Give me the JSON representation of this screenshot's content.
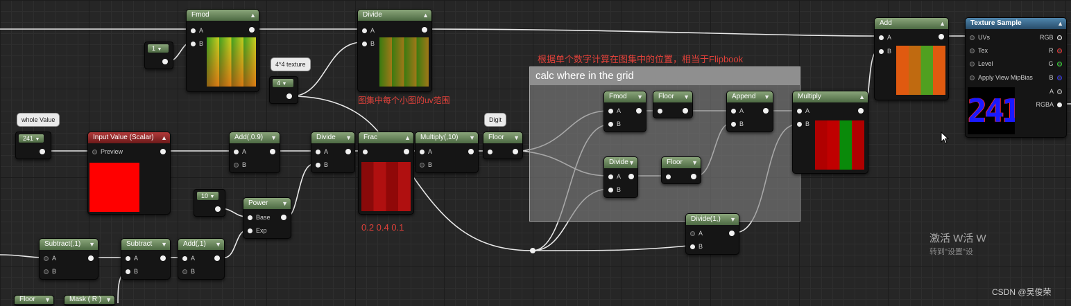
{
  "nodes": {
    "fmod_top": {
      "title": "Fmod",
      "a": "A",
      "b": "B"
    },
    "divide_top": {
      "title": "Divide",
      "a": "A",
      "b": "B"
    },
    "add_top": {
      "title": "Add",
      "a": "A",
      "b": "B"
    },
    "texture_sample": {
      "title": "Texture Sample",
      "uvs": "UVs",
      "tex": "Tex",
      "level": "Level",
      "apply": "Apply View MipBias",
      "out_rgb": "RGB",
      "out_r": "R",
      "out_g": "G",
      "out_b": "B",
      "out_a": "A",
      "out_rgba": "RGBA",
      "preview_number": "241"
    },
    "input_value": {
      "title": "Input Value (Scalar)",
      "preview": "Preview"
    },
    "add_09": {
      "title": "Add(,0.9)",
      "a": "A",
      "b": "B"
    },
    "divide_mid": {
      "title": "Divide",
      "a": "A",
      "b": "B"
    },
    "frac": {
      "title": "Frac"
    },
    "multiply_10": {
      "title": "Multiply(,10)",
      "a": "A",
      "b": "B"
    },
    "floor_mid": {
      "title": "Floor"
    },
    "power": {
      "title": "Power",
      "base": "Base",
      "exp": "Exp"
    },
    "subtract_1": {
      "title": "Subtract(,1)",
      "a": "A",
      "b": "B"
    },
    "subtract": {
      "title": "Subtract",
      "a": "A",
      "b": "B"
    },
    "add_1": {
      "title": "Add(,1)",
      "a": "A",
      "b": "B"
    },
    "floor_bottom": {
      "title": "Floor"
    },
    "mask_r": {
      "title": "Mask ( R )"
    },
    "fmod_inner": {
      "title": "Fmod",
      "a": "A",
      "b": "B"
    },
    "floor_inner1": {
      "title": "Floor"
    },
    "append": {
      "title": "Append",
      "a": "A",
      "b": "B"
    },
    "divide_inner": {
      "title": "Divide",
      "a": "A",
      "b": "B"
    },
    "floor_inner2": {
      "title": "Floor"
    },
    "multiply_big": {
      "title": "Multiply",
      "a": "A",
      "b": "B"
    },
    "divide_1": {
      "title": "Divide(1,)",
      "a": "A",
      "b": "B"
    }
  },
  "constants": {
    "const_1": "1",
    "const_4": "4",
    "const_241": "241",
    "const_10": "10"
  },
  "bubbles": {
    "texture_4x4": "4*4 texture",
    "whole_value": "whole Value",
    "digit": "Digit"
  },
  "comment": {
    "title": "calc where in the grid"
  },
  "annotations": {
    "flipbook_cn": "根据单个数字计算在图集中的位置，相当于Flipbook",
    "uv_range_cn": "图集中每个小图的uv范围",
    "frac_values": "0.2 0.4 0.1"
  },
  "watermarks": {
    "activate_line1": "激活 W活 W",
    "activate_line2": "转到\"设置\"设",
    "csdn": "CSDN @吴俊荣"
  },
  "colors": {
    "canvas_bg": "#262626",
    "node_header_green": "#6b8a5e",
    "node_header_red": "#9e2d2d",
    "node_header_blue": "#3d6c90",
    "annotation_red": "#e0413a"
  }
}
